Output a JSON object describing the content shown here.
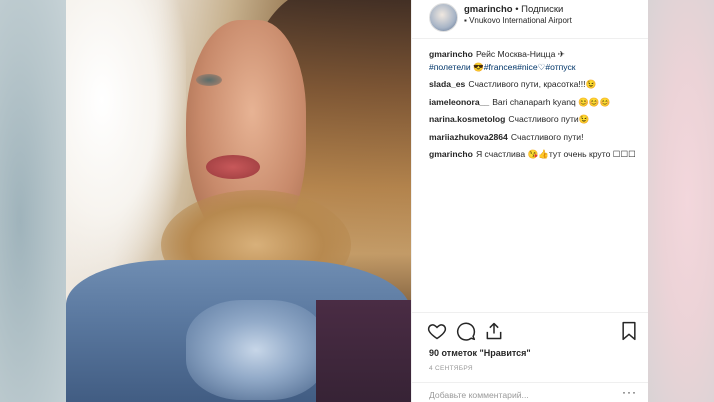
{
  "post": {
    "username": "gmarincho",
    "follow_label": "Подписки",
    "location": "Vnukovo International Airport",
    "likes_text": "90 отметок \"Нравится\"",
    "date_text": "4 СЕНТЯБРЯ",
    "add_comment_placeholder": "Добавьте комментарий...",
    "more_dots": "···"
  },
  "caption": {
    "user": "gmarincho",
    "text": "Рейс Москва-Ницца ✈",
    "tags": "#полетели 😎#franceя#nice♡#отпуск"
  },
  "comments": [
    {
      "user": "slada_es",
      "text": "Счастливого пути, красотка!!!😉"
    },
    {
      "user": "iameleonora__",
      "text": "Bari chanaparh kyanq 😊😊😊"
    },
    {
      "user": "narina.kosmetolog",
      "text": "Счастливого пути😉"
    },
    {
      "user": "mariiazhukova2864",
      "text": "Счастливого пути!"
    },
    {
      "user": "gmarincho",
      "text": "Я счастлива 😘👍тут очень круто ☐☐☐"
    }
  ],
  "icons": [
    "heart-icon",
    "comment-icon",
    "share-icon",
    "bookmark-icon"
  ]
}
